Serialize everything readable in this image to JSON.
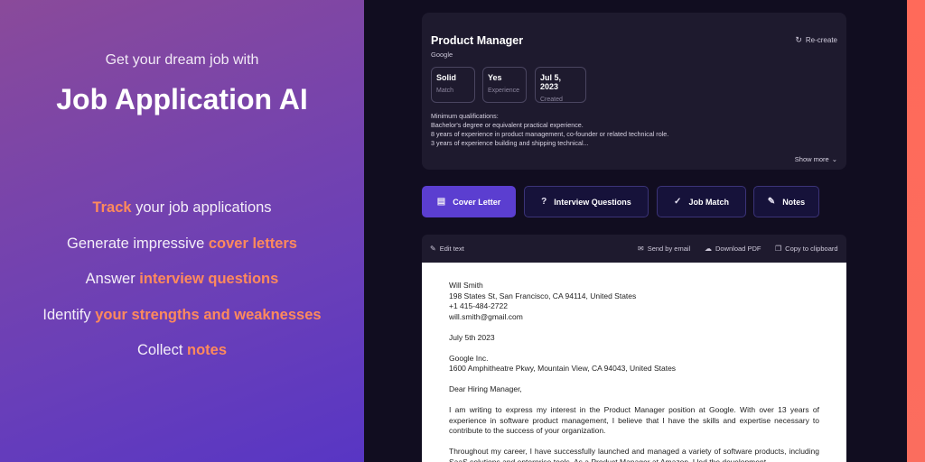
{
  "promo": {
    "pretitle": "Get your dream job with",
    "title": "Job Application AI",
    "features": [
      {
        "pre": "",
        "hl": "Track",
        "post": " your job applications"
      },
      {
        "pre": "Generate impressive ",
        "hl": "cover letters",
        "post": ""
      },
      {
        "pre": "Answer ",
        "hl": "interview questions",
        "post": ""
      },
      {
        "pre": "Identify ",
        "hl": "your strengths and weaknesses",
        "post": ""
      },
      {
        "pre": "Collect ",
        "hl": "notes",
        "post": ""
      }
    ]
  },
  "job": {
    "title": "Product Manager",
    "company": "Google",
    "recreate_label": "Re-create",
    "recreate_icon": "refresh-icon",
    "stats": [
      {
        "value": "Solid",
        "label": "Match"
      },
      {
        "value": "Yes",
        "label": "Experience"
      },
      {
        "value": "Jul 5, 2023",
        "label": "Created"
      }
    ],
    "description": [
      "Minimum qualifications:",
      "Bachelor's degree or equivalent practical experience.",
      "8 years of experience in product management, co-founder or related technical role.",
      "3 years of experience building and shipping technical..."
    ],
    "show_more_label": "Show more"
  },
  "tabs": [
    {
      "label": "Cover Letter",
      "icon": "document-icon",
      "active": true
    },
    {
      "label": "Interview Questions",
      "icon": "question-icon",
      "active": false
    },
    {
      "label": "Job Match",
      "icon": "check-icon",
      "active": false
    },
    {
      "label": "Notes",
      "icon": "pencil-icon",
      "active": false
    }
  ],
  "toolbar": {
    "edit": "Edit text",
    "send": "Send by email",
    "download": "Download PDF",
    "copy": "Copy to clipboard"
  },
  "letter": {
    "sender": [
      "Will Smith",
      "198 States St, San Francisco, CA 94114, United States",
      "+1 415-484-2722",
      "will.smith@gmail.com"
    ],
    "date": "July 5th 2023",
    "recipient": [
      "Google Inc.",
      "1600 Amphitheatre Pkwy, Mountain View, CA 94043, United States"
    ],
    "salutation": "Dear Hiring Manager,",
    "paragraph1": "I am writing to express my interest in the Product Manager position at Google. With over 13 years of experience in software product management, I believe that I have the skills and expertise necessary to contribute to the success of your organization.",
    "paragraph2": "Throughout my career, I have successfully launched and managed a variety of software products, including SaaS solutions and enterprise tools. As a Product Manager at Amazon, I led the development"
  },
  "colors": {
    "accent": "#5b3ed0",
    "highlight": "#ff8a5c",
    "strip": "#fb6d5e"
  }
}
